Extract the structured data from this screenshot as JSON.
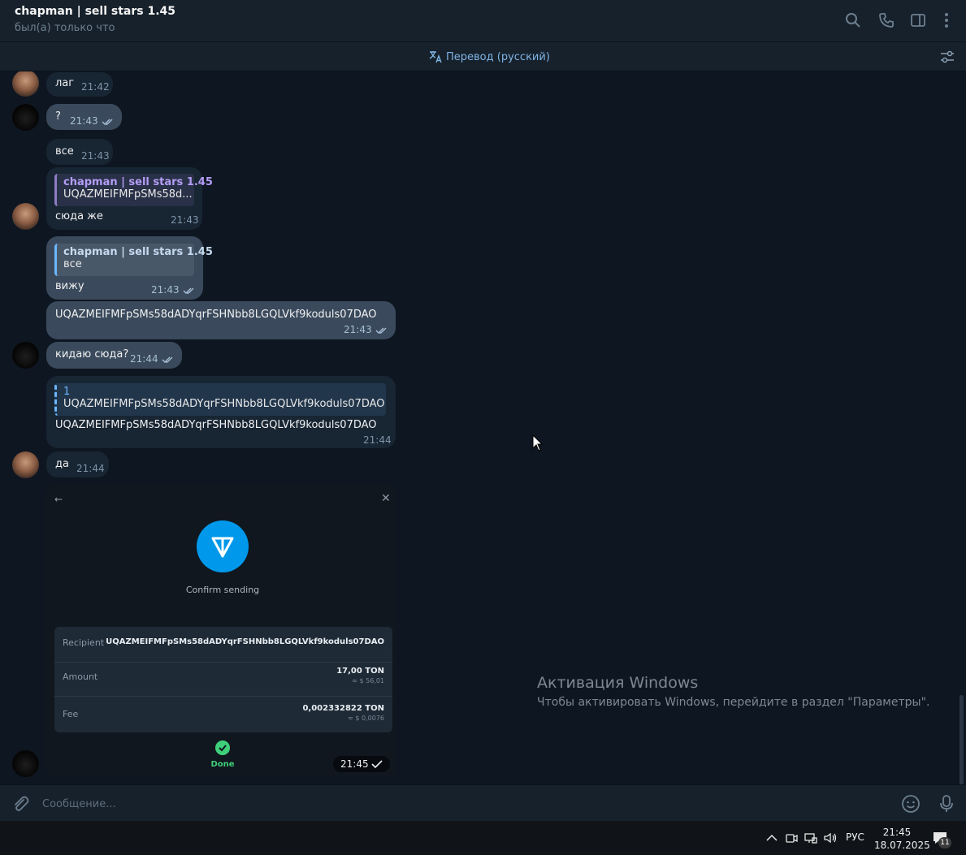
{
  "header": {
    "title": "chapman | sell stars 1.45",
    "status": "был(а) только что"
  },
  "translate_bar": {
    "label": "Перевод (русский)"
  },
  "messages": [
    {
      "text": "лаг",
      "time": "21:42"
    },
    {
      "text": "?",
      "time": "21:43"
    },
    {
      "text": "все",
      "time": "21:43"
    },
    {
      "reply_name": "chapman | sell stars 1.45",
      "reply_text": "UQAZMEIFMFpSMs58d...",
      "text": "сюда же",
      "time": "21:43"
    },
    {
      "reply_name": "chapman | sell stars 1.45",
      "reply_text": "все",
      "text": "вижу",
      "time": "21:43"
    },
    {
      "text": "UQAZMEIFMFpSMs58dADYqrFSHNbb8LGQLVkf9koduls07DAO",
      "time": "21:43"
    },
    {
      "text": "кидаю сюда?",
      "time": "21:44"
    },
    {
      "reply_name": "1",
      "reply_text": "UQAZMEIFMFpSMs58dADYqrFSHNbb8LGQLVkf9koduls07DAO",
      "text": "UQAZMEIFMFpSMs58dADYqrFSHNbb8LGQLVkf9koduls07DAO",
      "time": "21:44"
    },
    {
      "text": "да",
      "time": "21:44"
    }
  ],
  "photo": {
    "back": "←",
    "close": "✕",
    "confirm_label": "Confirm sending",
    "recipient_label": "Recipient",
    "recipient_value": "UQAZMEIFMFpSMs58dADYqrFSHNbb8LGQLVkf9koduls07DAO",
    "amount_label": "Amount",
    "amount_value": "17,00 TON",
    "amount_usd": "≈ $ 56,01",
    "fee_label": "Fee",
    "fee_value": "0,002332822 TON",
    "fee_usd": "≈ $ 0,0076",
    "done_label": "Done",
    "time": "21:45"
  },
  "watermark": {
    "title": "Активация Windows",
    "subtitle": "Чтобы активировать Windows, перейдите в раздел \"Параметры\"."
  },
  "composer": {
    "placeholder": "Сообщение..."
  },
  "taskbar": {
    "lang": "РУС",
    "time": "21:45",
    "date": "18.07.2025",
    "notifications": "11"
  },
  "colors": {
    "background": "#0e1621",
    "panel": "#17212b",
    "incoming": "#182533",
    "outgoing": "#2b5278",
    "accent": "#6ab7ff",
    "ton_blue": "#0098ea",
    "done_green": "#3fcf7a"
  },
  "icons": [
    "search-icon",
    "phone-icon",
    "sidebar-icon",
    "more-vertical-icon",
    "translate-icon",
    "tune-icon",
    "attach-icon",
    "emoji-icon",
    "mic-icon",
    "double-check-icon",
    "ton-logo-icon",
    "check-circle-icon"
  ]
}
